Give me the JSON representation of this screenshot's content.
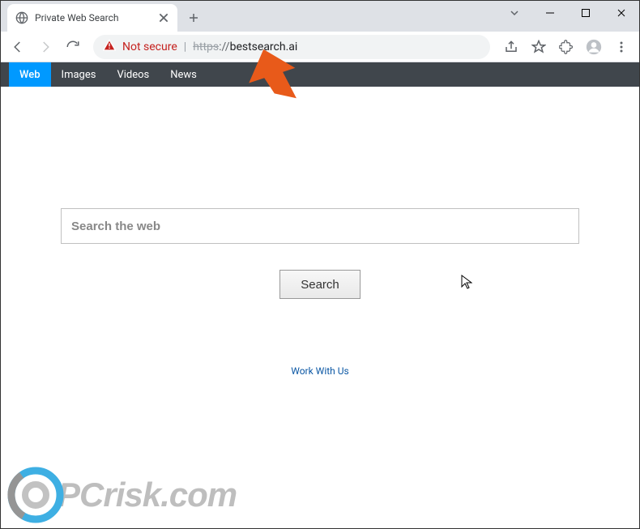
{
  "browser": {
    "tab_title": "Private Web Search",
    "omnibox": {
      "not_secure": "Not secure",
      "https_struck": "https",
      "url_sep": "://",
      "domain": "bestsearch.ai"
    }
  },
  "site": {
    "nav": [
      {
        "label": "Web",
        "active": true
      },
      {
        "label": "Images",
        "active": false
      },
      {
        "label": "Videos",
        "active": false
      },
      {
        "label": "News",
        "active": false
      }
    ],
    "search_placeholder": "Search the web",
    "search_button": "Search",
    "footer_link": "Work With Us"
  },
  "watermark": {
    "text": "PCrisk.com"
  }
}
